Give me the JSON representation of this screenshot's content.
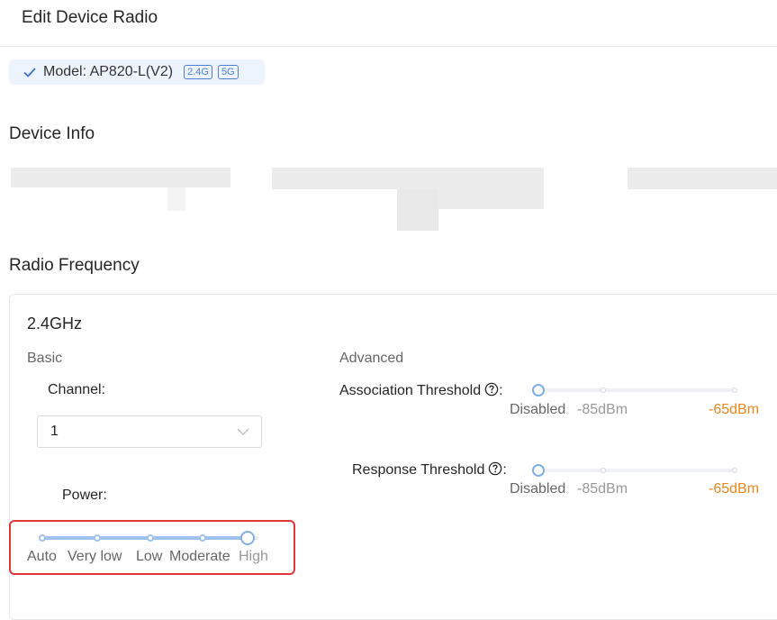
{
  "header": {
    "title": "Edit Device Radio"
  },
  "model": {
    "text": "Model: AP820-L(V2)",
    "bands": [
      "2.4G",
      "5G"
    ]
  },
  "device_info": {
    "title": "Device Info"
  },
  "radio": {
    "title": "Radio Frequency",
    "band_title": "2.4GHz",
    "basic_label": "Basic",
    "advanced_label": "Advanced",
    "channel": {
      "label": "Channel:",
      "value": "1"
    },
    "power": {
      "label": "Power:",
      "levels": [
        "Auto",
        "Very low",
        "Low",
        "Moderate",
        "High"
      ],
      "selected": "High"
    },
    "association_threshold": {
      "label": "Association Threshold",
      "suffix": ":",
      "marks": [
        "Disabled",
        "-85dBm",
        "-65dBm"
      ],
      "selected": "Disabled"
    },
    "response_threshold": {
      "label": "Response Threshold",
      "suffix": ":",
      "marks": [
        "Disabled",
        "-85dBm",
        "-65dBm"
      ],
      "selected": "Disabled"
    }
  },
  "colors": {
    "accent": "#80aee8",
    "highlight": "#e0353a",
    "warning": "#f0861c"
  }
}
